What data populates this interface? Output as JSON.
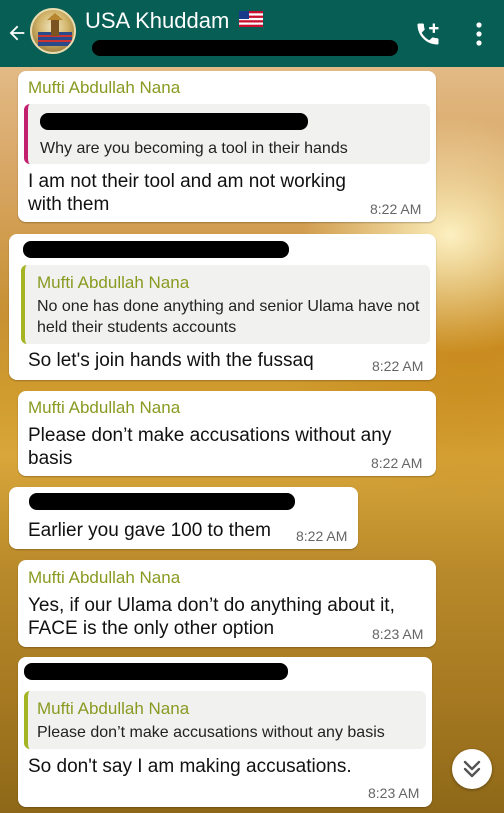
{
  "header": {
    "title": "USA Khuddam",
    "flag": "🇺🇸",
    "bg_color": "#075e54",
    "icons": [
      "back-arrow-icon",
      "add-call-icon",
      "more-vert-icon"
    ]
  },
  "messages": [
    {
      "sender": "Mufti Abdullah Nana",
      "quote": {
        "text": "Why are you becoming a tool in their hands"
      },
      "text": "I am not their tool and am not working with them",
      "time": "8:22 AM"
    },
    {
      "quote": {
        "sender": "Mufti Abdullah Nana",
        "text": "No one has done anything and senior Ulama have not held their students accounts"
      },
      "text": "So let's join hands with the fussaq",
      "time": "8:22 AM"
    },
    {
      "sender": "Mufti Abdullah Nana",
      "text": "Please don’t make accusations without any basis",
      "time": "8:22 AM"
    },
    {
      "text": "Earlier you gave 100 to them",
      "time": "8:22 AM"
    },
    {
      "sender": "Mufti Abdullah Nana",
      "text": "Yes, if our Ulama don’t do anything about it, FACE is the only other option",
      "time": "8:23 AM"
    },
    {
      "quote": {
        "sender": "Mufti Abdullah Nana",
        "text": "Please don’t make accusations without any basis"
      },
      "text": "So don't say I am making accusations.",
      "time": "8:23 AM"
    }
  ],
  "colors": {
    "sender": "#8a9a21",
    "quote_bar_pink": "#c2206e",
    "quote_bar_olive": "#a5b422"
  },
  "scroll_button": {
    "icon": "double-chevron-down-icon"
  }
}
